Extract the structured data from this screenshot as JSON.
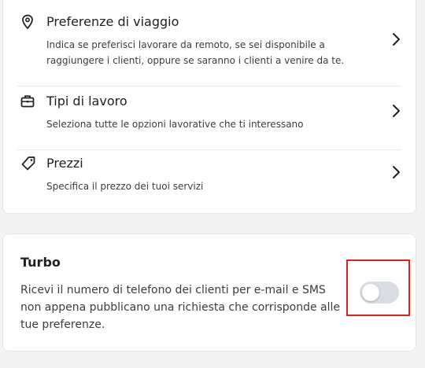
{
  "settings": {
    "items": [
      {
        "icon": "map-pin-icon",
        "title": "Preferenze di viaggio",
        "description": "Indica se preferisci lavorare da remoto, se sei disponibile a raggiungere i clienti, oppure se saranno i clienti a venire da te."
      },
      {
        "icon": "briefcase-icon",
        "title": "Tipi di lavoro",
        "description": "Seleziona tutte le opzioni lavorative che ti interessano"
      },
      {
        "icon": "price-tag-icon",
        "title": "Prezzi",
        "description": "Specifica il prezzo dei tuoi servizi"
      }
    ]
  },
  "turbo": {
    "title": "Turbo",
    "description": "Ricevi il numero di telefono dei clienti per e-mail e SMS non appena pubblicano una richiesta che corrisponde alle tue preferenze.",
    "toggle_on": false
  },
  "colors": {
    "highlight_border": "#e0201e",
    "toggle_off_track": "#d9dde3"
  }
}
